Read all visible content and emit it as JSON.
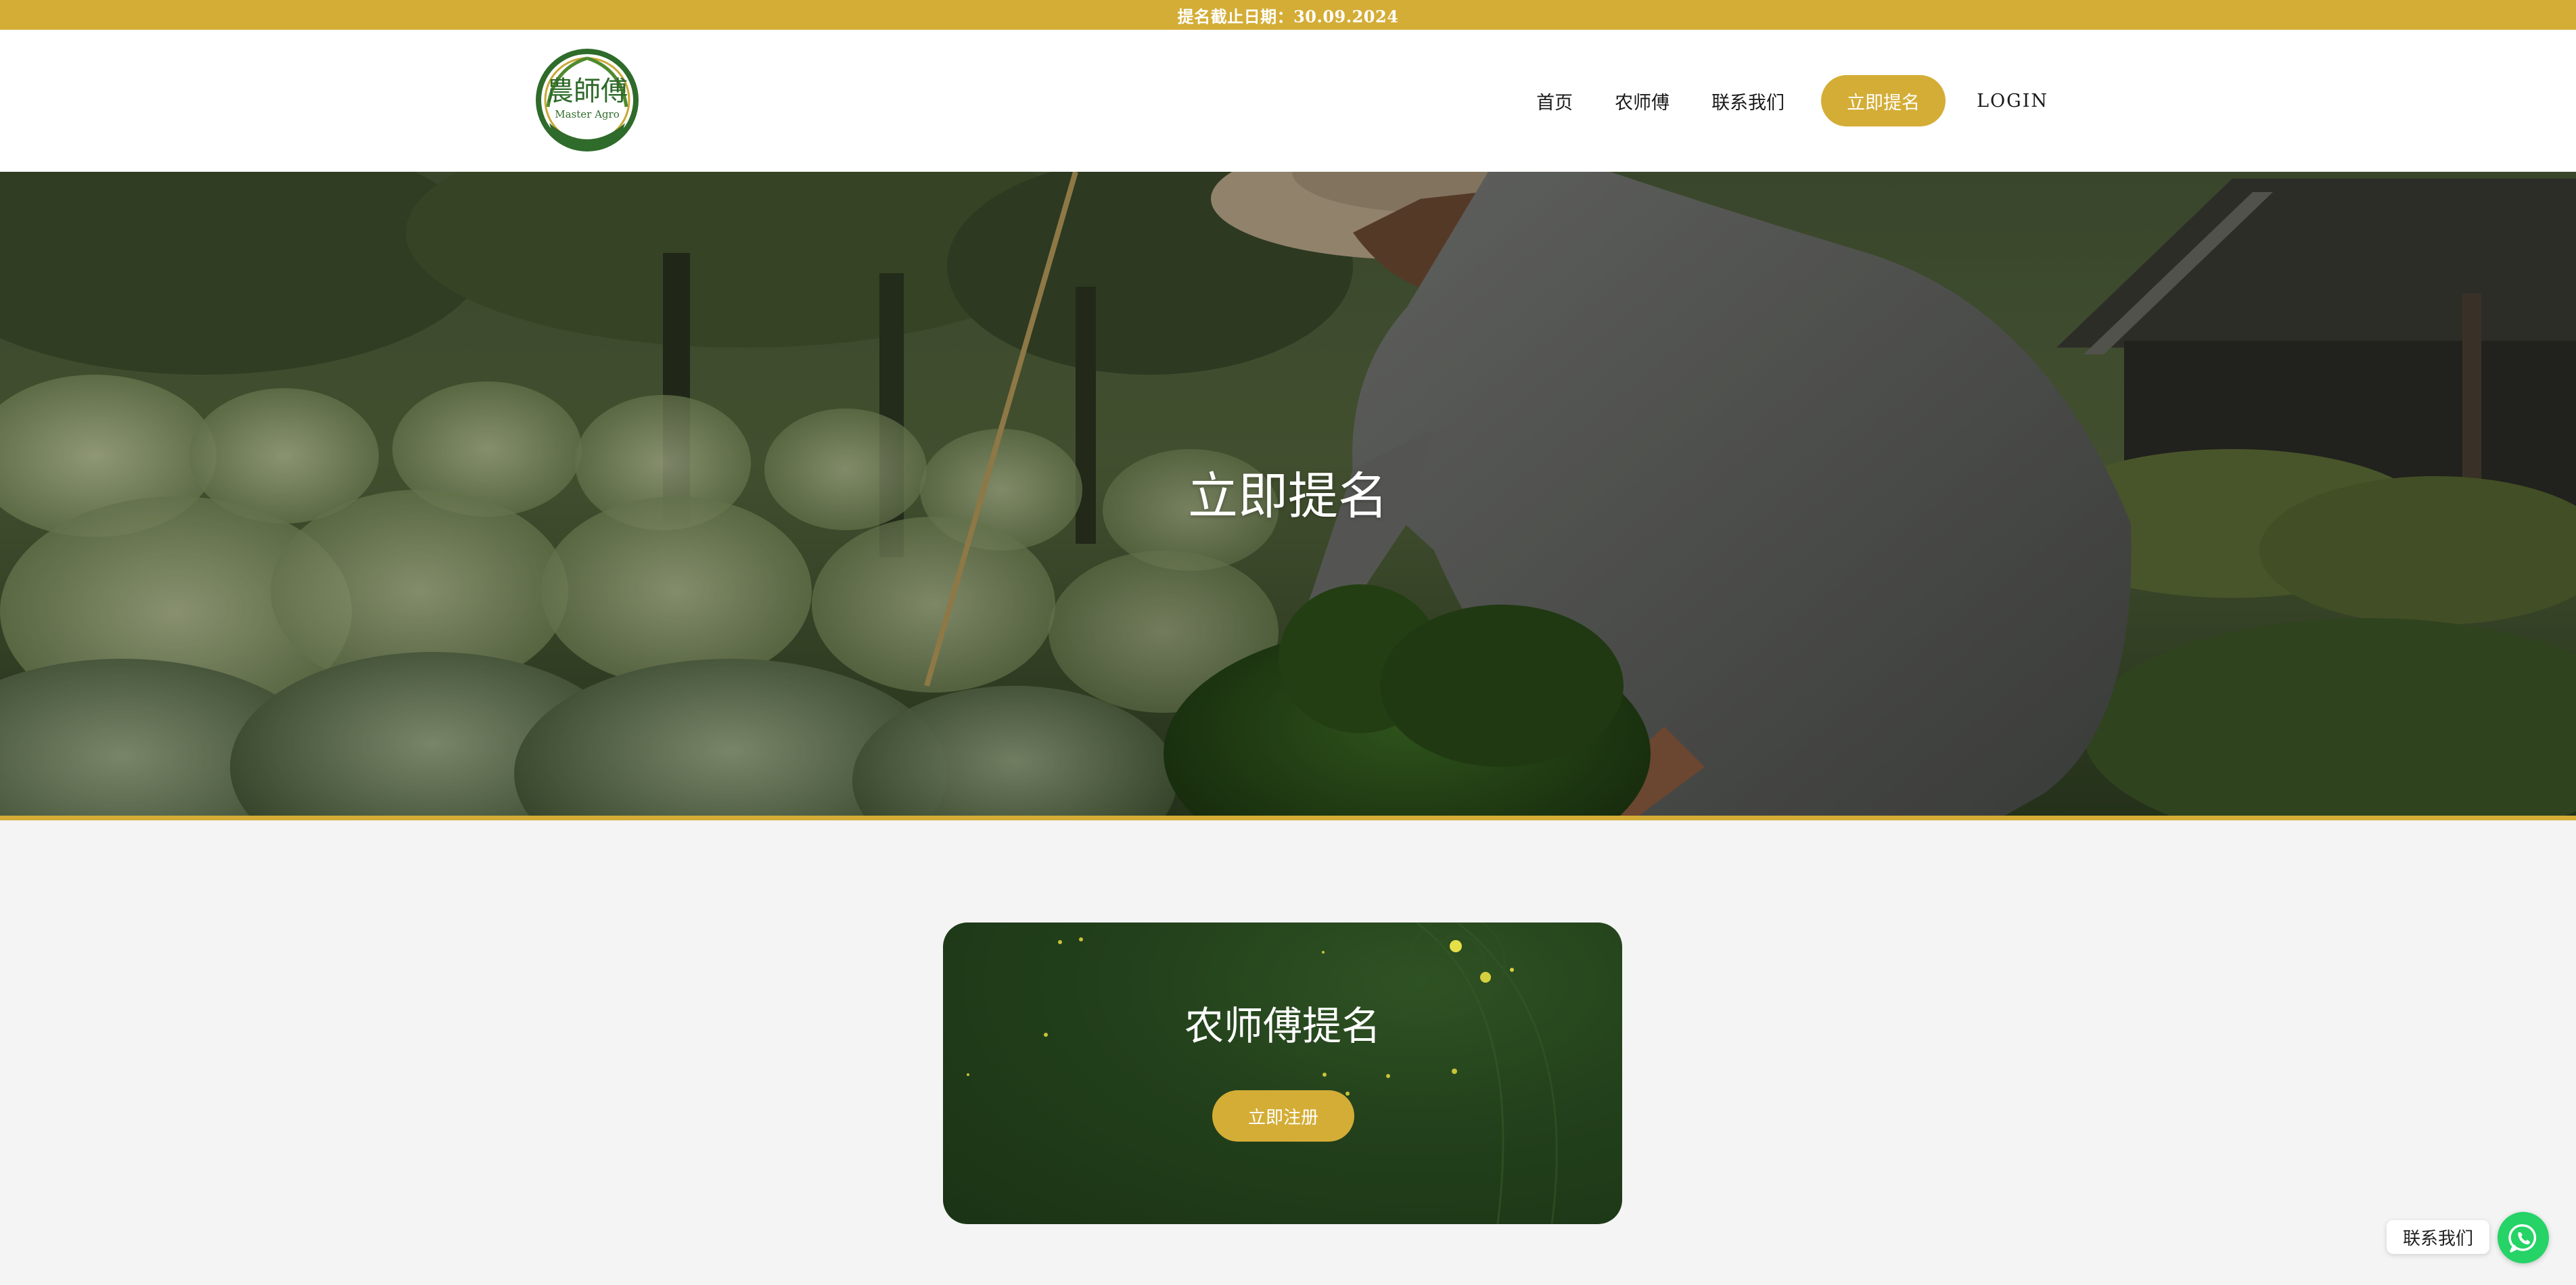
{
  "announcement": {
    "text": "提名截止日期：30.09.2024"
  },
  "header": {
    "logo": {
      "text_top": "農師傅",
      "text_sub": "Master Agro"
    },
    "nav": {
      "home": "首页",
      "master": "农师傅",
      "contact": "联系我们",
      "nominate": "立即提名",
      "login": "LOGIN"
    }
  },
  "hero": {
    "title": "立即提名"
  },
  "card": {
    "title": "农师傅提名",
    "button": "立即注册"
  },
  "whatsapp": {
    "label": "联系我们"
  },
  "colors": {
    "accent_gold": "#d4ad36",
    "card_green": "#22401b",
    "whatsapp_green": "#25d366",
    "page_bg": "#f4f4f4"
  },
  "icons": {
    "logo": "master-agro-logo",
    "whatsapp": "whatsapp-icon"
  }
}
